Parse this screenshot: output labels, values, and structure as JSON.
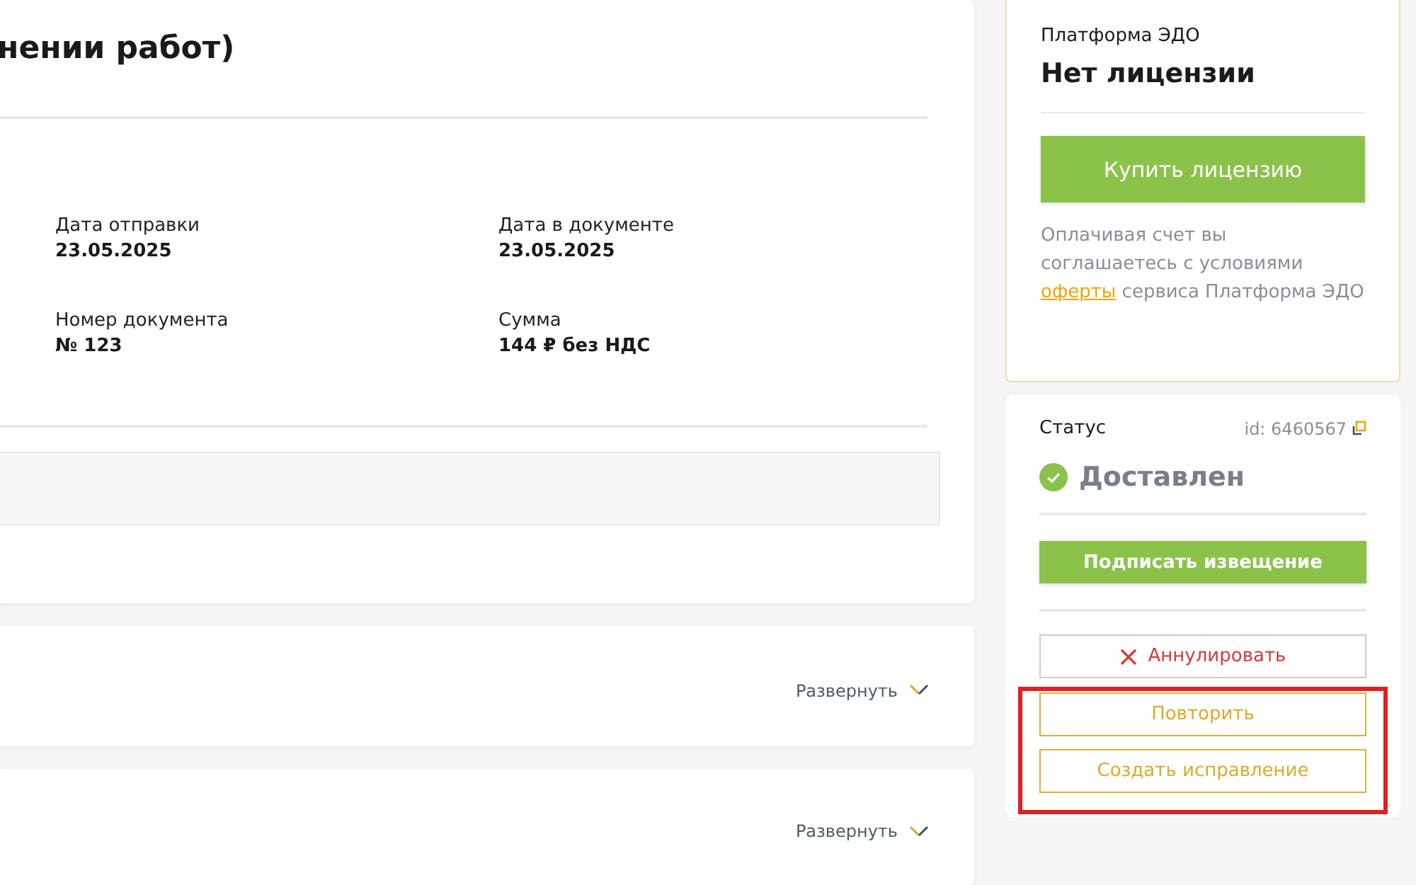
{
  "document": {
    "title": "нении работ)",
    "fields": [
      {
        "label": "Дата отправки",
        "value": "23.05.2025"
      },
      {
        "label": "Дата в документе",
        "value": "23.05.2025"
      },
      {
        "label": "Номер документа",
        "value": "№ 123"
      },
      {
        "label": "Сумма",
        "value": "144 ₽ без НДС"
      }
    ]
  },
  "sections": [
    {
      "expand_label": "Развернуть"
    },
    {
      "expand_label": "Развернуть"
    }
  ],
  "license": {
    "platform": "Платформа ЭДО",
    "status": "Нет лицензии",
    "buy_button": "Купить лицензию",
    "note_before": "Оплачивая счет вы соглашаетесь с условиями",
    "note_link": "оферты",
    "note_after": "сервиса Платформа ЭДО"
  },
  "status": {
    "label": "Статус",
    "id": "id: 6460567",
    "value": "Доставлен",
    "primary_action": "Подписать извещение",
    "actions": [
      {
        "kind": "danger",
        "label": "Аннулировать",
        "highlighted": false
      },
      {
        "kind": "warning",
        "label": "Повторить",
        "highlighted": true
      },
      {
        "kind": "warning",
        "label": "Создать исправление",
        "highlighted": true
      }
    ]
  }
}
